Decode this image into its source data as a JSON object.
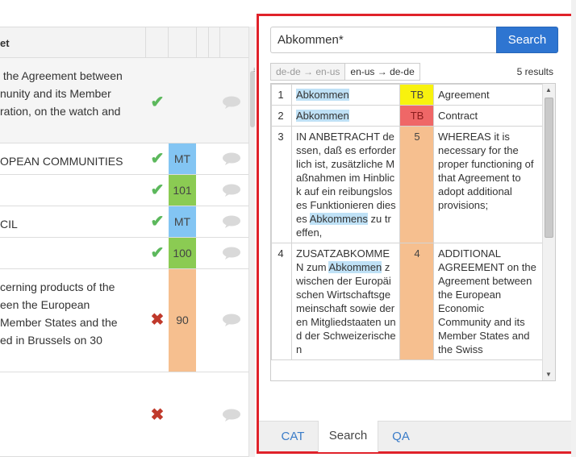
{
  "editor": {
    "column_header": "et",
    "rows": [
      {
        "text": " the Agreement between\nnunity and its Member\nration, on the watch and",
        "status": "ok",
        "match": "",
        "match_class": ""
      },
      {
        "text": "OPEAN COMMUNITIES",
        "status": "ok",
        "match": "MT",
        "match_class": "mt"
      },
      {
        "text": "",
        "status": "ok",
        "match": "101",
        "match_class": "g"
      },
      {
        "text": "CIL",
        "status": "ok",
        "match": "MT",
        "match_class": "mt"
      },
      {
        "text": "",
        "status": "ok",
        "match": "100",
        "match_class": "g"
      },
      {
        "text": "cerning products of the\neen the European\nMember States and the\ned in Brussels on 30",
        "status": "bad",
        "match": "90",
        "match_class": "o"
      },
      {
        "text": "",
        "status": "bad",
        "match": "",
        "match_class": ""
      }
    ],
    "icons": {
      "ok": "checkmark-icon",
      "bad": "cross-icon",
      "comment": "comment-icon"
    }
  },
  "search": {
    "query": "Abkommen*",
    "button_label": "Search",
    "directions": [
      "de-de → en-us",
      "en-us → de-de"
    ],
    "active_direction": 1,
    "results_count": "5 results",
    "results": [
      {
        "num": "1",
        "src": [
          {
            "t": "Abkommen",
            "hl": true
          }
        ],
        "score": "TB",
        "score_class": "tb-y",
        "tgt": "Agreement"
      },
      {
        "num": "2",
        "src": [
          {
            "t": "Abkommen",
            "hl": true
          }
        ],
        "score": "TB",
        "score_class": "tb-r",
        "tgt": "Contract"
      },
      {
        "num": "3",
        "src": [
          {
            "t": "IN ANBETRACHT dessen, daß es erforderlich ist, zusätzliche Maßnahmen im Hinblick auf ein reibungsloses Funktionieren dieses ",
            "hl": false
          },
          {
            "t": "Abkommens",
            "hl": true
          },
          {
            "t": " zu treffen,",
            "hl": false
          }
        ],
        "score": "5",
        "score_class": "o",
        "tgt": "WHEREAS it is necessary for the proper functioning of that Agreement to adopt additional provisions;"
      },
      {
        "num": "4",
        "src": [
          {
            "t": "ZUSATZABKOMMEN zum ",
            "hl": false
          },
          {
            "t": "Abkommen",
            "hl": true
          },
          {
            "t": " zwischen der Europäischen Wirtschaftsgemeinschaft sowie deren Mitgliedstaaten und der Schweizerischen",
            "hl": false
          }
        ],
        "score": "4",
        "score_class": "o",
        "tgt": "ADDITIONAL AGREEMENT on the Agreement between the European Economic Community and its Member States and the Swiss"
      }
    ]
  },
  "tabs": [
    {
      "label": "CAT",
      "active": false
    },
    {
      "label": "Search",
      "active": true
    },
    {
      "label": "QA",
      "active": false
    }
  ],
  "colors": {
    "accent": "#2e75d1",
    "highlight_border": "#e0222a",
    "match_mt": "#83c5f3",
    "match_green": "#8bcb53",
    "match_fuzzy": "#f6bf8f",
    "tb_yellow": "#f8f20e",
    "tb_red": "#ef6767"
  }
}
